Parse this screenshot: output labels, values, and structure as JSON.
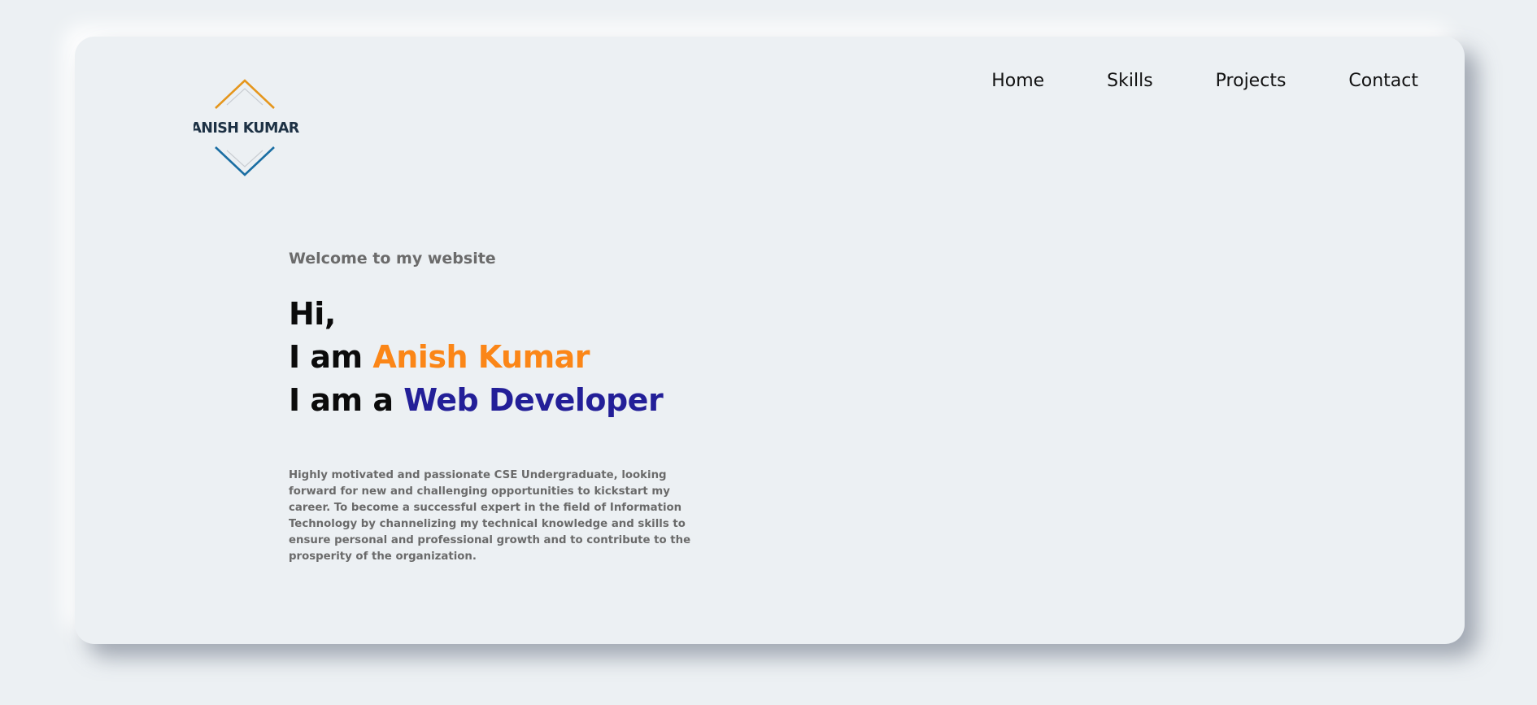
{
  "brand": {
    "logo_text": "ANISH KUMAR",
    "top_chevron_color": "#e5961c",
    "bottom_chevron_color": "#1a6ea3",
    "text_color": "#1d3144"
  },
  "nav": {
    "items": [
      {
        "label": "Home"
      },
      {
        "label": "Skills"
      },
      {
        "label": "Projects"
      },
      {
        "label": "Contact"
      }
    ]
  },
  "hero": {
    "welcome": "Welcome to my website",
    "line1": "Hi,",
    "line2_prefix": "I am ",
    "line2_highlight": "Anish Kumar",
    "line3_prefix": "I am a ",
    "line3_highlight": "Web Developer",
    "bio": "Highly motivated and passionate CSE Undergraduate, looking forward for new and challenging opportunities to kickstart my career. To become a successful expert in the field of Information Technology by channelizing my technical knowledge and skills to ensure personal and professional growth and to contribute to the prosperity of the organization."
  },
  "colors": {
    "background": "#ecf0f3",
    "name_accent": "#fb8617",
    "role_accent": "#231f98"
  }
}
